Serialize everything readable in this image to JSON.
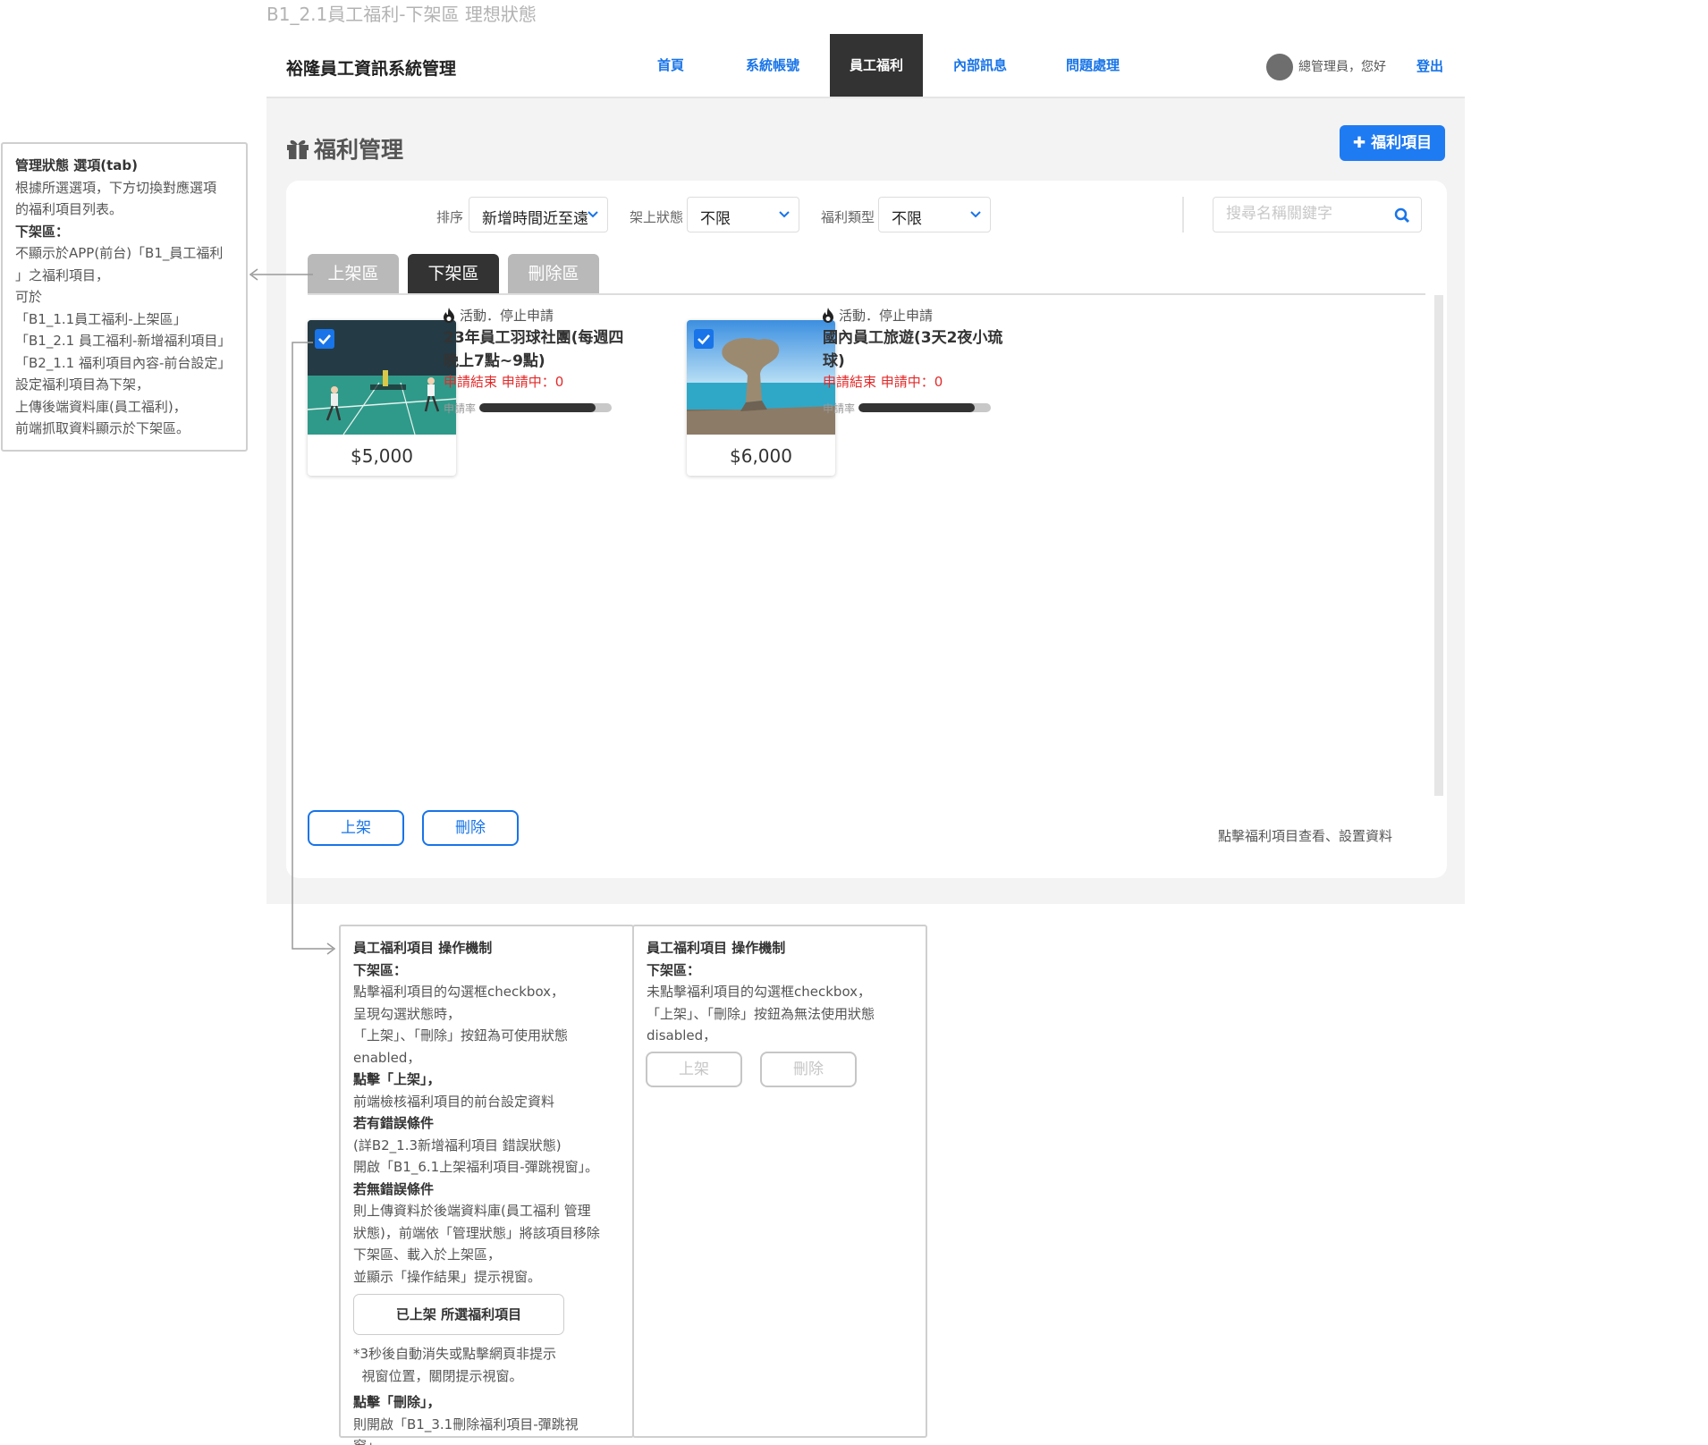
{
  "page": {
    "title": "B1_2.1員工福利-下架區 理想狀態"
  },
  "header": {
    "brand": "裕隆員工資訊系統管理",
    "nav": [
      "首頁",
      "系統帳號",
      "員工福利",
      "內部訊息",
      "問題處理"
    ],
    "active_nav": "員工福利",
    "greeting": "總管理員，您好",
    "logout": "登出"
  },
  "section": {
    "title": "福利管理",
    "add_button": "福利項目"
  },
  "filters": {
    "sort_label": "排序",
    "sort_value": "新增時間近至遠",
    "shelf_label": "架上狀態",
    "shelf_value": "不限",
    "type_label": "福利類型",
    "type_value": "不限",
    "search_placeholder": "搜尋名稱關鍵字"
  },
  "tabs": [
    "上架區",
    "下架區",
    "刪除區"
  ],
  "active_tab": "下架區",
  "items": [
    {
      "price": "$5,000",
      "meta": "活動．停止申請",
      "title": "23年員工羽球社團(每週四晚上7點~9點)",
      "status": "申請結束 申請中：0",
      "rate_label": "申請率",
      "rate": 0.88,
      "checked": true
    },
    {
      "price": "$6,000",
      "meta": "活動．停止申請",
      "title": "國內員工旅遊(3天2夜小琉球)",
      "status": "申請結束 申請中：0",
      "rate_label": "申請率",
      "rate": 0.88,
      "checked": true
    }
  ],
  "actions": {
    "publish": "上架",
    "delete": "刪除",
    "hint": "點擊福利項目查看、設置資料"
  },
  "notes": {
    "left_title": "管理狀態 選項(tab)",
    "left_lines": [
      "根據所選選項，下方切換對應選項",
      "的福利項目列表。"
    ],
    "left_sub": "下架區：",
    "left_lines2": [
      "不顯示於APP(前台)「B1_員工福利",
      "」之福利項目，",
      "可於",
      "「B1_1.1員工福利-上架區」",
      "「B1_2.1 員工福利-新增福利項目」",
      "「B2_1.1 福利項目內容-前台設定」",
      "設定福利項目為下架，",
      "上傳後端資料庫(員工福利)，",
      "前端抓取資料顯示於下架區。"
    ],
    "mid_title": "員工福利項目 操作機制",
    "mid_sub": "下架區：",
    "mid_lines1": [
      "點擊福利項目的勾選框checkbox，",
      "呈現勾選狀態時，",
      "「上架」、「刪除」按鈕為可使用狀態",
      "enabled，"
    ],
    "mid_click_publish": "點擊「上架」，",
    "mid_lines2": [
      "前端檢核福利項目的前台設定資料"
    ],
    "mid_err": "若有錯誤條件",
    "mid_lines3": [
      "(詳B2_1.3新增福利項目 錯誤狀態)",
      "開啟「B1_6.1上架福利項目-彈跳視窗」。"
    ],
    "mid_noerr": "若無錯誤條件",
    "mid_lines4": [
      "則上傳資料於後端資料庫(員工福利 管理",
      "狀態)，前端依「管理狀態」將該項目移除",
      "下架區、載入於上架區，",
      "並顯示「操作結果」提示視窗。"
    ],
    "mid_toast": "已上架 所選福利項目",
    "mid_lines5": [
      "*3秒後自動消失或點擊網頁非提示",
      "  視窗位置，關閉提示視窗。"
    ],
    "mid_click_delete": "點擊「刪除」，",
    "mid_lines6": [
      "則開啟「B1_3.1刪除福利項目-彈跳視",
      "窗」。"
    ],
    "right_title": "員工福利項目 操作機制",
    "right_sub": "下架區：",
    "right_lines": [
      "未點擊福利項目的勾選框checkbox，",
      "「上架」、「刪除」按鈕為無法使用狀態",
      "disabled，"
    ],
    "right_btn_publish": "上架",
    "right_btn_delete": "刪除"
  },
  "colors": {
    "accent": "#1874e8",
    "dark": "#333333",
    "error": "#e32a2a"
  }
}
